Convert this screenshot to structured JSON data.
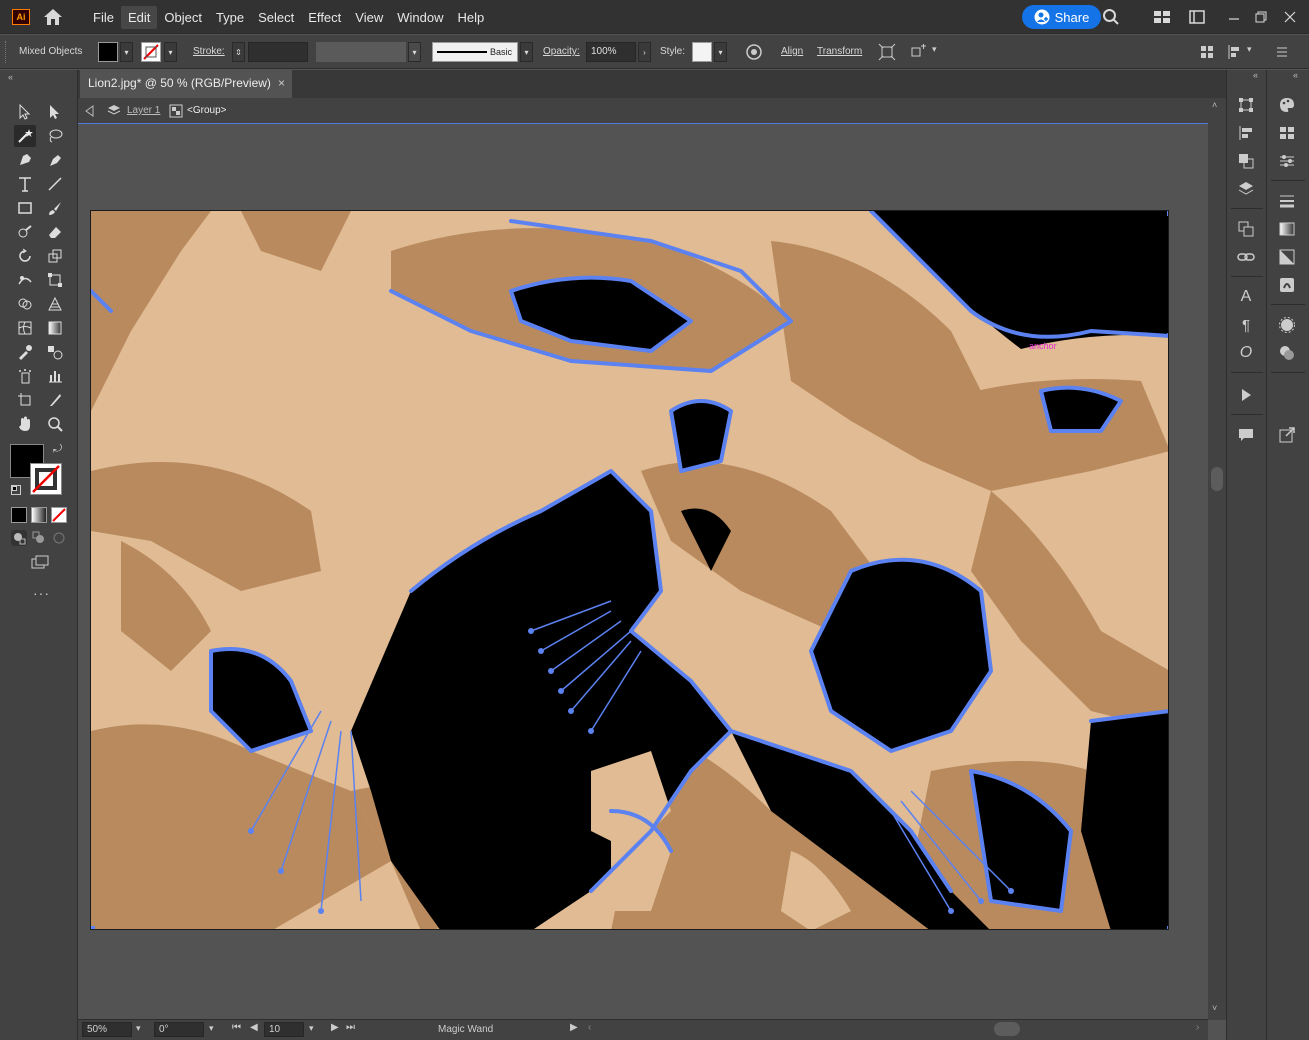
{
  "app": {
    "logo_text": "Ai"
  },
  "menu": {
    "items": [
      "File",
      "Edit",
      "Object",
      "Type",
      "Select",
      "Effect",
      "View",
      "Window",
      "Help"
    ],
    "active_index": 1,
    "share_label": "Share"
  },
  "control_bar": {
    "selection_label": "Mixed Objects",
    "stroke_label": "Stroke:",
    "stroke_profile": "Basic",
    "opacity_label": "Opacity:",
    "opacity_value": "100%",
    "style_label": "Style:",
    "align_label": "Align",
    "transform_label": "Transform"
  },
  "document": {
    "tab_title": "Lion2.jpg* @ 50 % (RGB/Preview)",
    "close_glyph": "×",
    "breadcrumb_layer": "Layer 1",
    "breadcrumb_group": "<Group>",
    "anchor_hint": "anchor"
  },
  "status_bar": {
    "zoom": "50%",
    "rotation": "0°",
    "artboard_number": "10",
    "tool_name": "Magic Wand"
  },
  "colors": {
    "light_tan": "#e0bb93",
    "mid_brown": "#b98a5e",
    "black": "#000000",
    "selection_blue": "#5b82f0",
    "share_blue": "#1473e6"
  },
  "tools": [
    "selection-tool",
    "direct-selection-tool",
    "magic-wand-tool",
    "lasso-tool",
    "pen-tool",
    "curvature-tool",
    "type-tool",
    "line-tool",
    "rectangle-tool",
    "paintbrush-tool",
    "shaper-tool",
    "eraser-tool",
    "rotate-tool",
    "scale-tool",
    "warp-tool",
    "free-transform-tool",
    "shape-builder-tool",
    "perspective-grid-tool",
    "mesh-tool",
    "gradient-tool",
    "eyedropper-tool",
    "blend-tool",
    "symbol-sprayer-tool",
    "column-graph-tool",
    "artboard-tool",
    "slice-tool",
    "hand-tool",
    "zoom-tool"
  ]
}
